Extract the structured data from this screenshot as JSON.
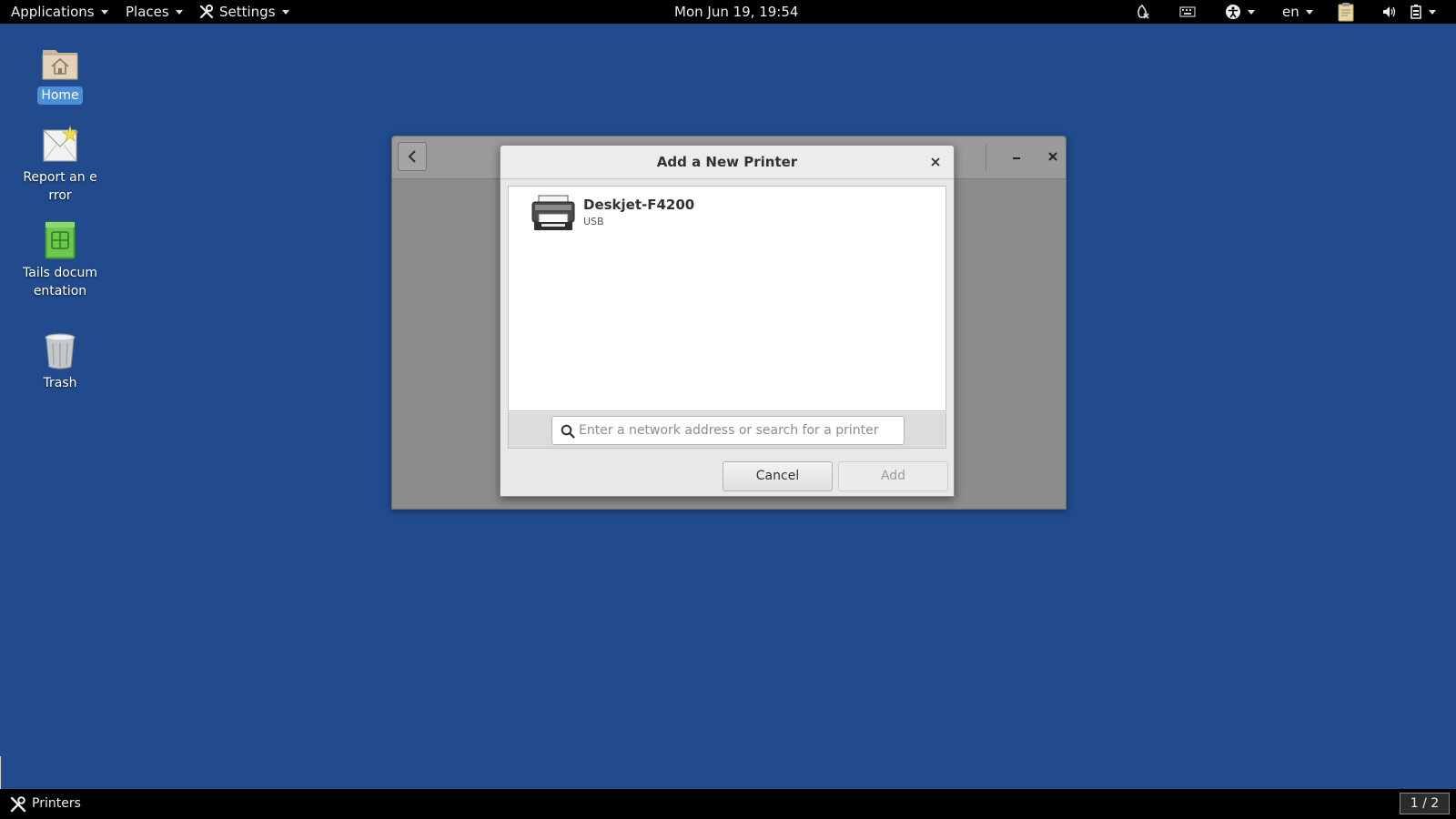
{
  "topbar": {
    "applications_label": "Applications",
    "places_label": "Places",
    "settings_label": "Settings",
    "clock": "Mon Jun 19, 19:54",
    "language": "en"
  },
  "desktop": {
    "icons": [
      {
        "label": "Home",
        "icon": "home-folder-icon"
      },
      {
        "label": "Report an error",
        "icon": "report-error-icon"
      },
      {
        "label": "Tails documentation",
        "icon": "tails-docs-icon"
      },
      {
        "label": "Trash",
        "icon": "trash-icon"
      }
    ]
  },
  "dialog": {
    "title": "Add a New Printer",
    "printers": [
      {
        "name": "Deskjet-F4200",
        "connection": "USB"
      }
    ],
    "search_placeholder": "Enter a network address or search for a printer",
    "search_value": "",
    "cancel_label": "Cancel",
    "add_label": "Add"
  },
  "taskbar": {
    "task_label": "Printers",
    "workspace": "1 / 2"
  },
  "colors": {
    "desktop_bg": "#214b8c",
    "selection": "#4a90d9"
  }
}
